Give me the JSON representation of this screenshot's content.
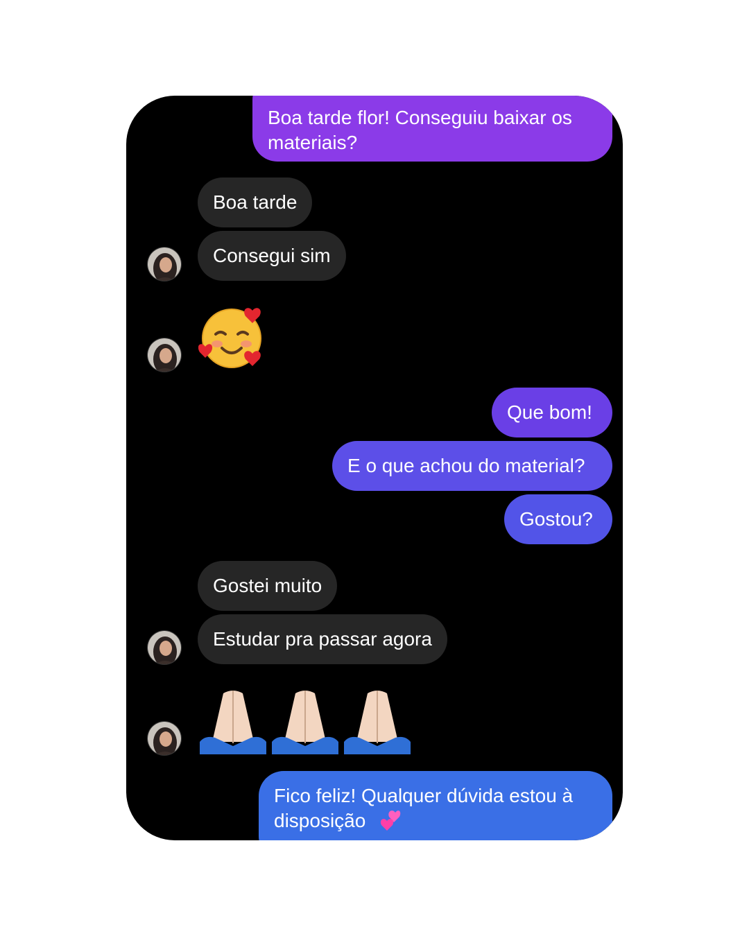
{
  "messages": {
    "m1": "Boa tarde flor! Conseguiu baixar os\nmateriais?",
    "m2": "Boa tarde",
    "m3": "Consegui sim",
    "m5": "Que bom!",
    "m6": "E o que achou do material?",
    "m7": "Gostou?",
    "m8": "Gostei muito",
    "m9": "Estudar pra passar agora",
    "m11": "Fico feliz! Qualquer dúvida estou à\ndisposição"
  },
  "colors": {
    "outgoing_top": "#8b3be8",
    "outgoing_mid": "#6a4ce6",
    "outgoing_bottom": "#3a6fe6",
    "incoming": "#262626",
    "background": "#000000"
  },
  "icons": {
    "smiling_hearts": "smiling-face-with-hearts-icon",
    "folded_hands": "folded-hands-icon",
    "two_hearts": "two-hearts-icon",
    "avatar": "contact-avatar"
  }
}
